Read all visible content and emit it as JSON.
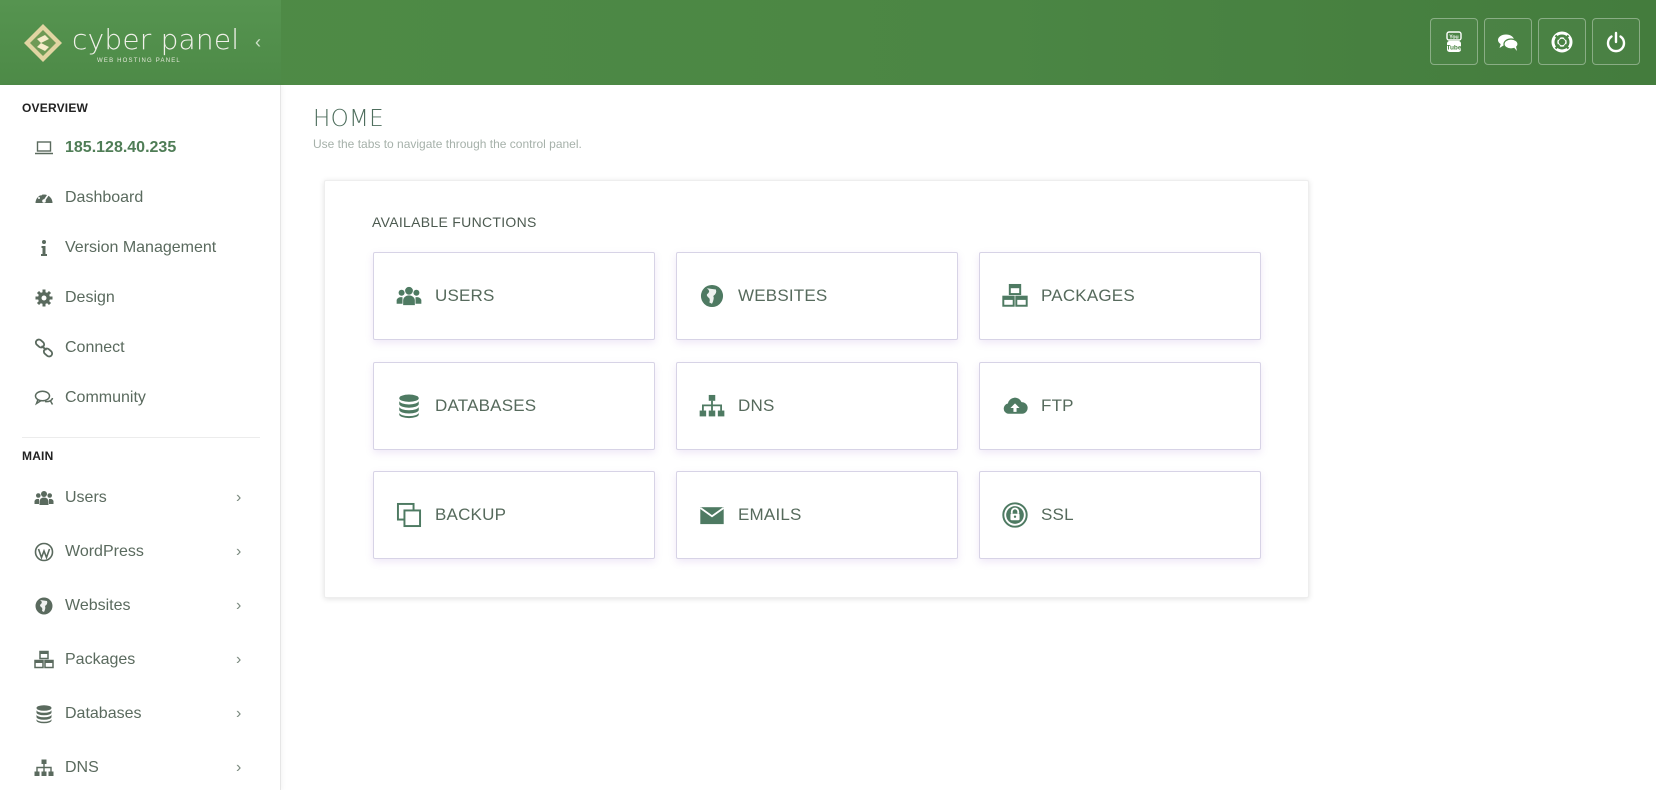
{
  "header": {
    "logo_text": "cyber panel",
    "logo_subtitle": "WEB HOSTING PANEL",
    "collapse_glyph": "‹",
    "buttons": [
      {
        "icon": "youtube-icon"
      },
      {
        "icon": "chat-icon"
      },
      {
        "icon": "support-icon"
      },
      {
        "icon": "power-icon"
      }
    ]
  },
  "sidebar": {
    "overview_heading": "OVERVIEW",
    "main_heading": "MAIN",
    "overview_items": [
      {
        "label": "185.128.40.235",
        "icon": "laptop-icon"
      },
      {
        "label": "Dashboard",
        "icon": "dashboard-icon"
      },
      {
        "label": "Version Management",
        "icon": "info-icon"
      },
      {
        "label": "Design",
        "icon": "gear-icon"
      },
      {
        "label": "Connect",
        "icon": "link-icon"
      },
      {
        "label": "Community",
        "icon": "chat-icon"
      }
    ],
    "main_items": [
      {
        "label": "Users",
        "icon": "users-icon"
      },
      {
        "label": "WordPress",
        "icon": "wordpress-icon"
      },
      {
        "label": "Websites",
        "icon": "globe-icon"
      },
      {
        "label": "Packages",
        "icon": "cubes-icon"
      },
      {
        "label": "Databases",
        "icon": "database-icon"
      },
      {
        "label": "DNS",
        "icon": "sitemap-icon"
      }
    ],
    "chevron_glyph": "›"
  },
  "main": {
    "title": "HOME",
    "subtitle": "Use the tabs to navigate through the control panel.",
    "functions_heading": "AVAILABLE FUNCTIONS",
    "tiles": [
      {
        "label": "USERS",
        "icon": "users-icon"
      },
      {
        "label": "WEBSITES",
        "icon": "globe-icon"
      },
      {
        "label": "PACKAGES",
        "icon": "cubes-icon"
      },
      {
        "label": "DATABASES",
        "icon": "database-icon"
      },
      {
        "label": "DNS",
        "icon": "sitemap-icon"
      },
      {
        "label": "FTP",
        "icon": "cloud-upload-icon"
      },
      {
        "label": "BACKUP",
        "icon": "copy-icon"
      },
      {
        "label": "EMAILS",
        "icon": "envelope-icon"
      },
      {
        "label": "SSL",
        "icon": "lock-icon"
      }
    ]
  },
  "colors": {
    "header_green": "#4b8644",
    "accent_text": "#4f7d56",
    "icon_green": "#4e7a62"
  }
}
